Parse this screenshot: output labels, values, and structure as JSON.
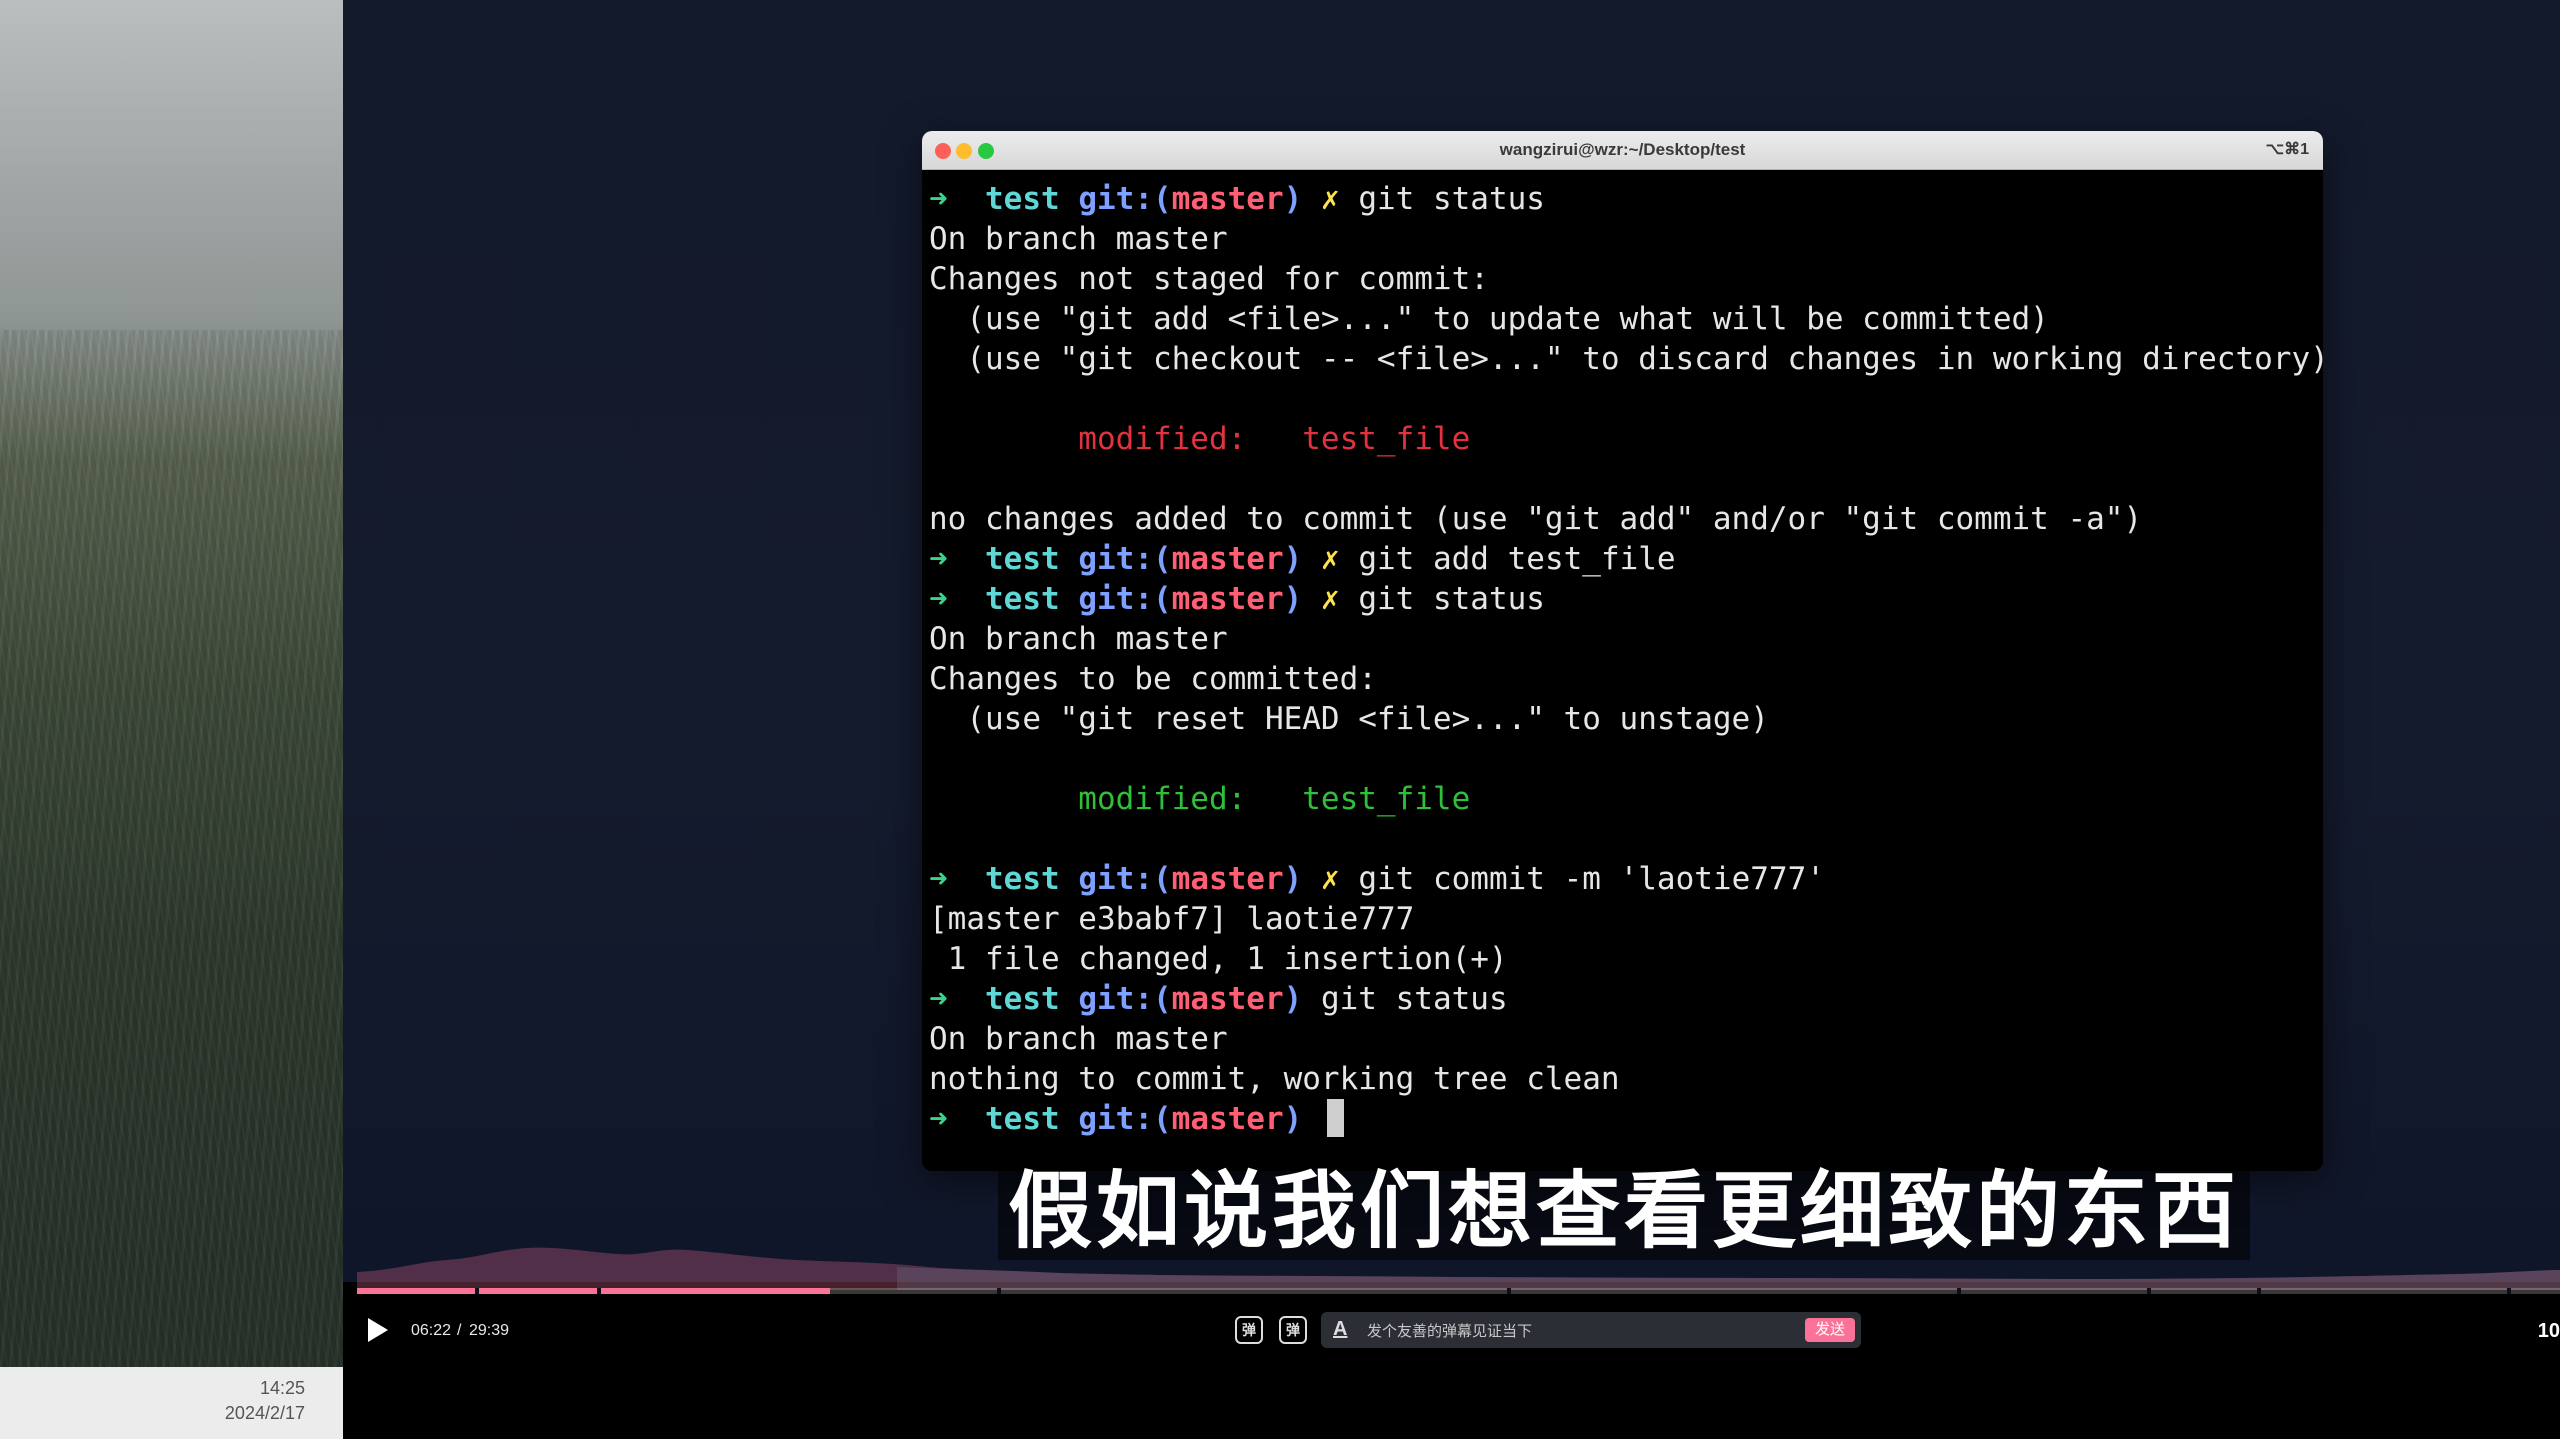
{
  "taskbar": {
    "time": "14:25",
    "date": "2024/2/17"
  },
  "terminal": {
    "title": "wangzirui@wzr:~/Desktop/test",
    "shortcut": "⌥⌘1",
    "prompt": {
      "arrow": "➜",
      "dir": "test",
      "git_prefix": "git:(",
      "branch": "master",
      "git_suffix": ")",
      "dirty_mark": "✗"
    },
    "lines": [
      {
        "kind": "cmd",
        "dirty": true,
        "text": "git status"
      },
      {
        "kind": "out",
        "text": "On branch master"
      },
      {
        "kind": "out",
        "text": "Changes not staged for commit:"
      },
      {
        "kind": "out",
        "text": "  (use \"git add <file>...\" to update what will be committed)"
      },
      {
        "kind": "out",
        "text": "  (use \"git checkout -- <file>...\" to discard changes in working directory)"
      },
      {
        "kind": "blank",
        "text": ""
      },
      {
        "kind": "mod-red",
        "text": "        modified:   test_file"
      },
      {
        "kind": "blank",
        "text": ""
      },
      {
        "kind": "out",
        "text": "no changes added to commit (use \"git add\" and/or \"git commit -a\")"
      },
      {
        "kind": "cmd",
        "dirty": true,
        "text": "git add test_file"
      },
      {
        "kind": "cmd",
        "dirty": true,
        "text": "git status"
      },
      {
        "kind": "out",
        "text": "On branch master"
      },
      {
        "kind": "out",
        "text": "Changes to be committed:"
      },
      {
        "kind": "out",
        "text": "  (use \"git reset HEAD <file>...\" to unstage)"
      },
      {
        "kind": "blank",
        "text": ""
      },
      {
        "kind": "mod-green",
        "text": "        modified:   test_file"
      },
      {
        "kind": "blank",
        "text": ""
      },
      {
        "kind": "cmd",
        "dirty": true,
        "text": "git commit -m 'laotie777'"
      },
      {
        "kind": "out",
        "text": "[master e3babf7] laotie777"
      },
      {
        "kind": "out",
        "text": " 1 file changed, 1 insertion(+)"
      },
      {
        "kind": "cmd",
        "dirty": false,
        "text": "git status"
      },
      {
        "kind": "out",
        "text": "On branch master"
      },
      {
        "kind": "out",
        "text": "nothing to commit, working tree clean"
      },
      {
        "kind": "cursor",
        "dirty": false,
        "text": ""
      }
    ]
  },
  "subtitle": "假如说我们想查看更细致的东西",
  "player": {
    "current_time": "06:22",
    "separator": "/",
    "total_time": "29:39",
    "progress_fraction": 0.2147,
    "danmaku_toggle_label": "弹",
    "danmaku_settings_label": "弹",
    "danmaku_style_icon": "A",
    "danmaku_placeholder": "发个友善的弹幕见证当下",
    "send_label": "发送",
    "right_edge_text": "10",
    "colors": {
      "accent": "#fb7299"
    }
  }
}
